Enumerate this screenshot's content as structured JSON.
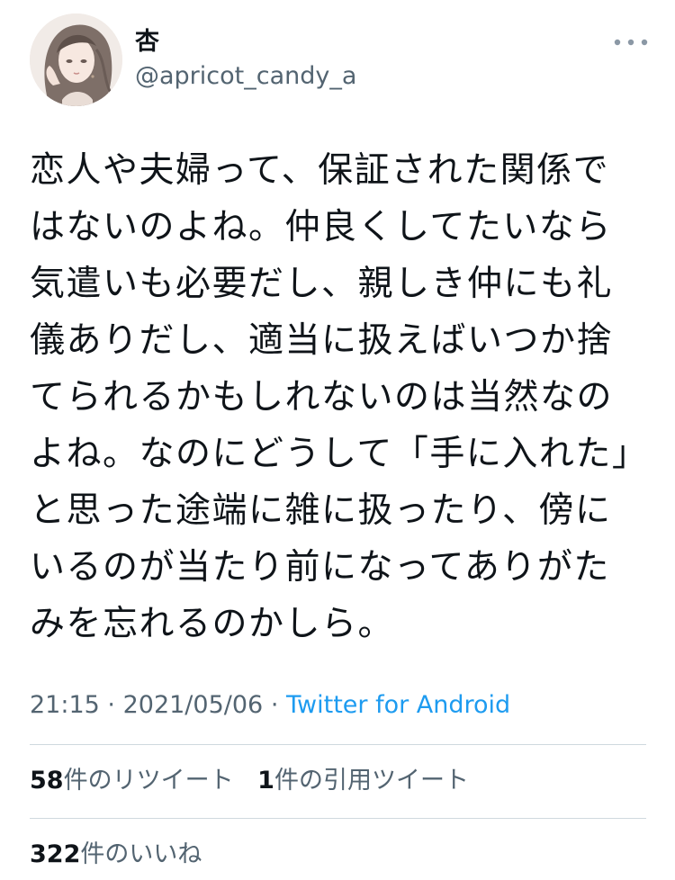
{
  "author": {
    "display_name": "杏",
    "handle": "@apricot_candy_a",
    "avatar": "user-avatar-illustration"
  },
  "more_icon": "more-horizontal-icon",
  "tweet": {
    "text": "恋人や夫婦って、保証された関係で\nはないのよね。仲良くしてたいなら\n気遣いも必要だし、親しき仲にも礼\n儀ありだし、適当に扱えばいつか捨\nてられるかもしれないのは当然なの\nよね。なのにどうして「手に入れた」\nと思った途端に雑に扱ったり、傍に\nいるのが当たり前になってありがた\nみを忘れるのかしら。",
    "time": "21:15",
    "date": "2021/05/06",
    "separator": "·",
    "source": "Twitter for Android"
  },
  "stats": {
    "retweets": {
      "count": "58",
      "label": "件のリツイート"
    },
    "quotes": {
      "count": "1",
      "label": "件の引用ツイート"
    },
    "likes": {
      "count": "322",
      "label": "件のいいね"
    }
  },
  "colors": {
    "text": "#0f1419",
    "secondary": "#536471",
    "link": "#1d9bf0",
    "divider": "#cfd9de"
  }
}
